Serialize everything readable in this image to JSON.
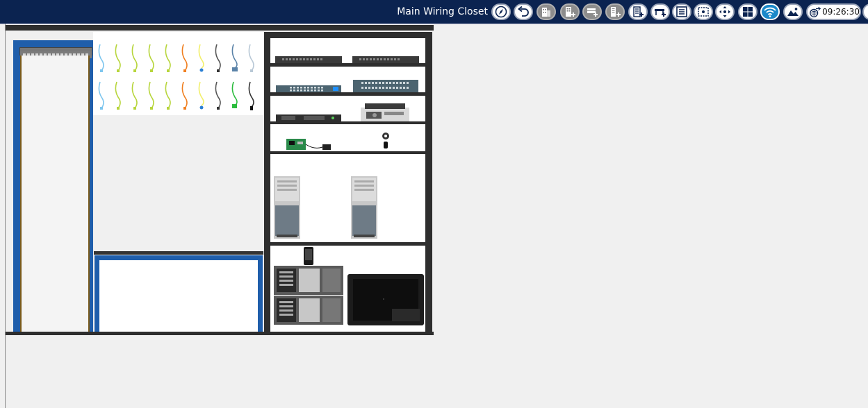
{
  "toolbar": {
    "location_title": "Main Wiring Closet",
    "clock": "09:26:30",
    "buttons": [
      {
        "icon": "navigation-compass-icon",
        "style": "white"
      },
      {
        "icon": "back-arrow-icon",
        "style": "white"
      },
      {
        "icon": "building-icon",
        "style": "grey"
      },
      {
        "icon": "new-city-icon",
        "style": "grey"
      },
      {
        "icon": "new-building-icon",
        "style": "grey"
      },
      {
        "icon": "new-closet-icon",
        "style": "grey"
      },
      {
        "icon": "new-rack-icon",
        "style": "white"
      },
      {
        "icon": "new-table-icon",
        "style": "white"
      },
      {
        "icon": "document-list-icon",
        "style": "white"
      },
      {
        "icon": "select-area-icon",
        "style": "white"
      },
      {
        "icon": "move-arrows-icon",
        "style": "white"
      },
      {
        "icon": "grid-view-icon",
        "style": "white"
      },
      {
        "icon": "wireless-icon",
        "style": "blue"
      },
      {
        "icon": "background-image-icon",
        "style": "white"
      }
    ]
  },
  "colors": {
    "topbar": "#0b2350",
    "rack": "#1f5eab",
    "shelf": "#2e2e2e",
    "background": "#f0f0f0",
    "cable_label": "#2a7fd4"
  }
}
